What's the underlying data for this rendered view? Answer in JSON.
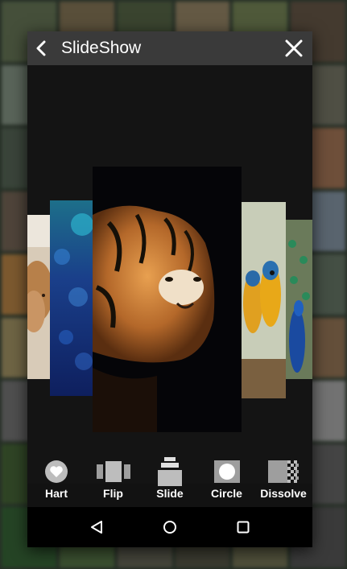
{
  "header": {
    "title": "SlideShow",
    "back_icon": "arrow-left-icon",
    "close_icon": "close-icon"
  },
  "slides": [
    {
      "subject": "deer",
      "icon": "deer-image"
    },
    {
      "subject": "blue bokeh",
      "icon": "bokeh-image"
    },
    {
      "subject": "tiger",
      "icon": "tiger-image"
    },
    {
      "subject": "macaws",
      "icon": "parrot-image"
    },
    {
      "subject": "peacock",
      "icon": "peacock-image"
    }
  ],
  "effects": [
    {
      "label": "Hart",
      "icon": "heart-icon"
    },
    {
      "label": "Flip",
      "icon": "flip-icon"
    },
    {
      "label": "Slide",
      "icon": "slide-icon"
    },
    {
      "label": "Circle",
      "icon": "circle-icon"
    },
    {
      "label": "Dissolve",
      "icon": "dissolve-icon"
    }
  ],
  "navigation": {
    "back": "nav-back-icon",
    "home": "nav-home-icon",
    "recents": "nav-recents-icon"
  },
  "colors": {
    "titlebar": "#3a3a3a",
    "dialog": "#121212",
    "navbar": "#000000"
  }
}
